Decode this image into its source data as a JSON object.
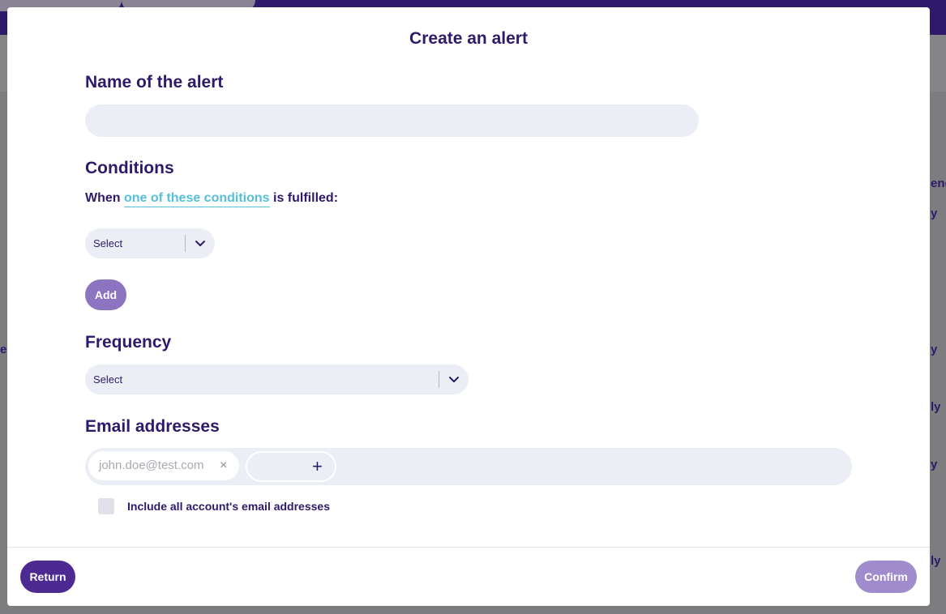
{
  "modal": {
    "title": "Create an alert",
    "name_section": {
      "heading": "Name of the alert",
      "input_value": "",
      "input_placeholder": ""
    },
    "conditions_section": {
      "heading": "Conditions",
      "when_prefix": "When",
      "when_link": "one of these conditions",
      "when_suffix": "is fulfilled:",
      "select_value": "Select",
      "add_label": "Add"
    },
    "frequency_section": {
      "heading": "Frequency",
      "select_value": "Select"
    },
    "email_section": {
      "heading": "Email addresses",
      "chips": [
        "john.doe@test.com"
      ],
      "remove_icon": "×",
      "add_icon": "+",
      "include_all_label": "Include all account's email addresses",
      "include_all_checked": false
    },
    "footer": {
      "return_label": "Return",
      "confirm_label": "Confirm"
    }
  },
  "background": {
    "partial_texts": [
      "y",
      "e",
      "y",
      "ly",
      "y",
      "ly",
      "enc"
    ]
  },
  "colors": {
    "brand_dark": "#2e1a6b",
    "primary_button": "#4c2a92",
    "disabled_button": "#a08ccd",
    "add_button": "#8c74c0",
    "link": "#56c0d8",
    "input_bg": "#eceef5"
  }
}
